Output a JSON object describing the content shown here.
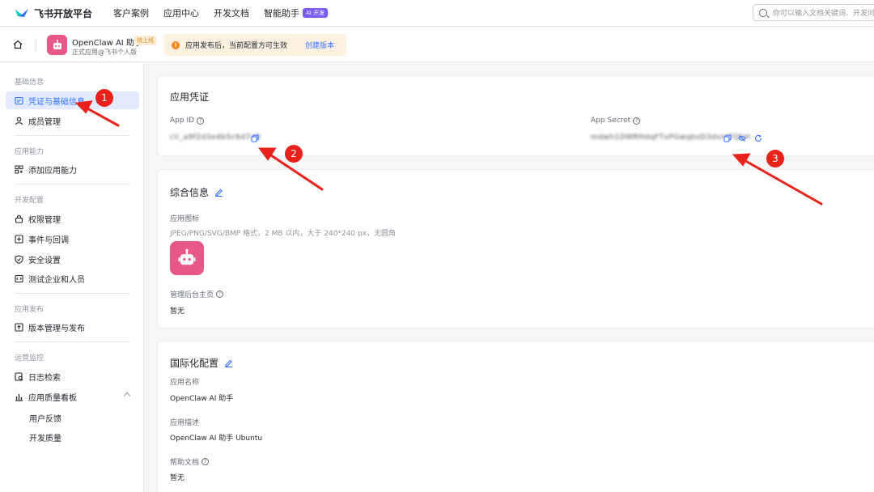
{
  "topnav": {
    "brand": "飞书开放平台",
    "links": [
      "客户案例",
      "应用中心",
      "开发文档",
      "智能助手"
    ],
    "ai_badge": "AI 开发",
    "search_placeholder": "你可以输入文档关键词、开发问题"
  },
  "app": {
    "name": "OpenClaw AI 助手",
    "status": "待上线",
    "subtitle": "正式应用@飞书个人版",
    "notice": "应用发布后，当前配置方可生效",
    "notice_link": "创建版本"
  },
  "sidebar": {
    "sections": [
      {
        "title": "基础信息",
        "items": [
          "凭证与基础信息",
          "成员管理"
        ]
      },
      {
        "title": "应用能力",
        "items": [
          "添加应用能力"
        ]
      },
      {
        "title": "开发配置",
        "items": [
          "权限管理",
          "事件与回调",
          "安全设置",
          "测试企业和人员"
        ]
      },
      {
        "title": "应用发布",
        "items": [
          "版本管理与发布"
        ]
      },
      {
        "title": "运营监控",
        "items": [
          "日志检索",
          "应用质量看板"
        ],
        "subitems": [
          "用户反馈",
          "开发质量"
        ]
      }
    ]
  },
  "credentials": {
    "title": "应用凭证",
    "app_id_label": "App ID",
    "app_id_value": "cli_a9f2d3e4b5c6d7e8",
    "app_secret_label": "App Secret",
    "app_secret_value": "mdwh1DWRHdqFTxPGwqbsD3dvmTQhH"
  },
  "general": {
    "title": "综合信息",
    "icon_label": "应用图标",
    "icon_hint": "JPEG/PNG/SVG/BMP 格式，2 MB 以内，大于 240*240 px，无圆角",
    "homepage_label": "管理后台主页",
    "homepage_value": "暂无"
  },
  "i18n": {
    "title": "国际化配置",
    "name_label": "应用名称",
    "name_value": "OpenClaw AI 助手",
    "desc_label": "应用描述",
    "desc_value": "OpenClaw AI 助手 Ubuntu",
    "help_label": "帮助文档",
    "help_value": "暂无"
  },
  "markers": [
    "1",
    "2",
    "3"
  ],
  "colors": {
    "accent": "#3370ff",
    "annotation": "#e8211a",
    "avatar": "#e8578a"
  }
}
